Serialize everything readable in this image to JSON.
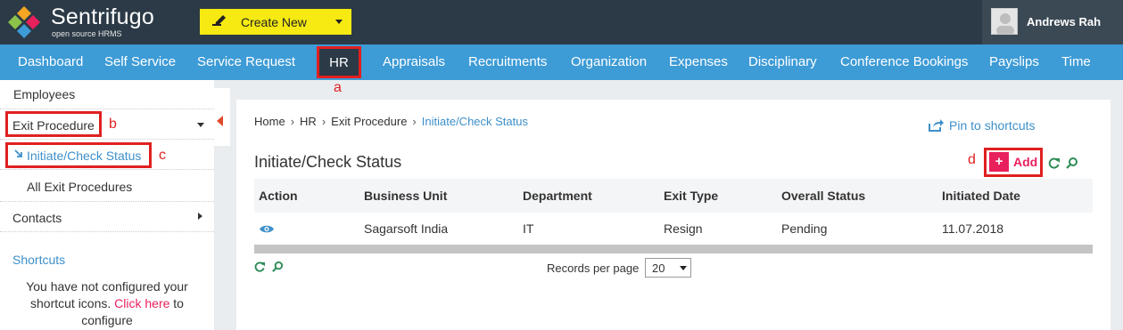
{
  "header": {
    "brand_name": "Sentrifugo",
    "brand_tagline": "open source HRMS",
    "create_label": "Create New",
    "user_name": "Andrews Rah"
  },
  "nav": {
    "items": [
      "Dashboard",
      "Self Service",
      "Service Request",
      "HR",
      "Appraisals",
      "Recruitments",
      "Organization",
      "Expenses",
      "Disciplinary",
      "Conference Bookings",
      "Payslips",
      "Time"
    ],
    "active": "HR"
  },
  "annotations": {
    "a": "a",
    "b": "b",
    "c": "c",
    "d": "d"
  },
  "sidebar": {
    "employees": "Employees",
    "exit_procedure": "Exit Procedure",
    "initiate": "Initiate/Check Status",
    "all_exit": "All Exit Procedures",
    "contacts": "Contacts",
    "shortcuts_title": "Shortcuts",
    "shortcuts_msg_1": "You have not configured your",
    "shortcuts_msg_2": "shortcut icons.",
    "shortcuts_link": "Click here",
    "shortcuts_msg_3": "to",
    "shortcuts_msg_4": "configure"
  },
  "breadcrumb": [
    "Home",
    "HR",
    "Exit Procedure",
    "Initiate/Check Status"
  ],
  "pin_label": "Pin to shortcuts",
  "page_title": "Initiate/Check Status",
  "add_label": "Add",
  "table": {
    "columns": [
      "Action",
      "Business Unit",
      "Department",
      "Exit Type",
      "Overall Status",
      "Initiated Date"
    ],
    "rows": [
      {
        "business_unit": "Sagarsoft India",
        "department": "IT",
        "exit_type": "Resign",
        "status": "Pending",
        "date": "11.07.2018"
      }
    ]
  },
  "pagination": {
    "label": "Records per page",
    "value": "20"
  },
  "colors": {
    "accent": "#3d9bd6",
    "header": "#2b3a46",
    "create": "#f6ea12",
    "add": "#e8205c",
    "annotation": "#e02020"
  }
}
